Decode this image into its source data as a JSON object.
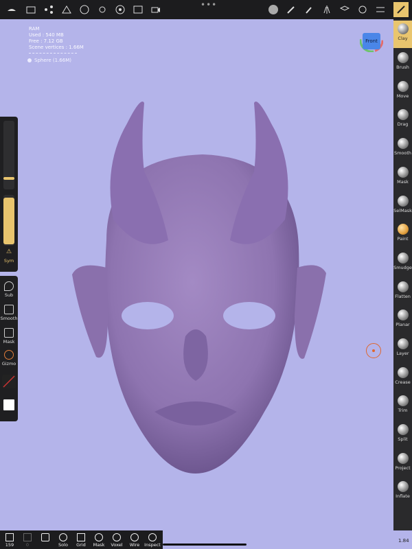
{
  "topbar": {
    "icons": [
      "menu-icon",
      "folder-icon",
      "scene-icon",
      "topology-icon",
      "mesh-icon",
      "light-icon",
      "material-icon",
      "image-icon",
      "camera-icon",
      "matcap-icon",
      "pen-icon",
      "brush-icon",
      "symmetry-icon",
      "layers-icon",
      "settings-icon",
      "sliders-icon",
      "tools-icon"
    ],
    "more": "•••"
  },
  "info": {
    "ram_label": "RAM",
    "used": "Used : 540 MB",
    "free": "Free : 7.12 GB",
    "vertices": "Scene vertices : 1.66M",
    "object": "Sphere (1.66M)"
  },
  "view": {
    "cube_label": "Front"
  },
  "tools": [
    {
      "label": "Clay",
      "active": true
    },
    {
      "label": "Brush"
    },
    {
      "label": "Move"
    },
    {
      "label": "Drag"
    },
    {
      "label": "Smooth"
    },
    {
      "label": "Mask"
    },
    {
      "label": "SelMask"
    },
    {
      "label": "Paint"
    },
    {
      "label": "Smudge"
    },
    {
      "label": "Flatten"
    },
    {
      "label": "Planar"
    },
    {
      "label": "Layer"
    },
    {
      "label": "Crease"
    },
    {
      "label": "Trim"
    },
    {
      "label": "Split"
    },
    {
      "label": "Project"
    },
    {
      "label": "Inflate"
    }
  ],
  "left": {
    "sym": "Sym",
    "sub": "Sub",
    "smooth": "Smooth",
    "mask": "Mask",
    "gizmo": "Gizmo"
  },
  "bottom": {
    "undo_count": "159",
    "redo_count": "0",
    "items": [
      "Solo",
      "Grid",
      "Mask",
      "Voxel",
      "Wire",
      "Inspect"
    ]
  },
  "version": "1.84",
  "colors": {
    "accent": "#e9c56e",
    "sculpt": "#8e74b0",
    "background": "#b4b4ea"
  }
}
